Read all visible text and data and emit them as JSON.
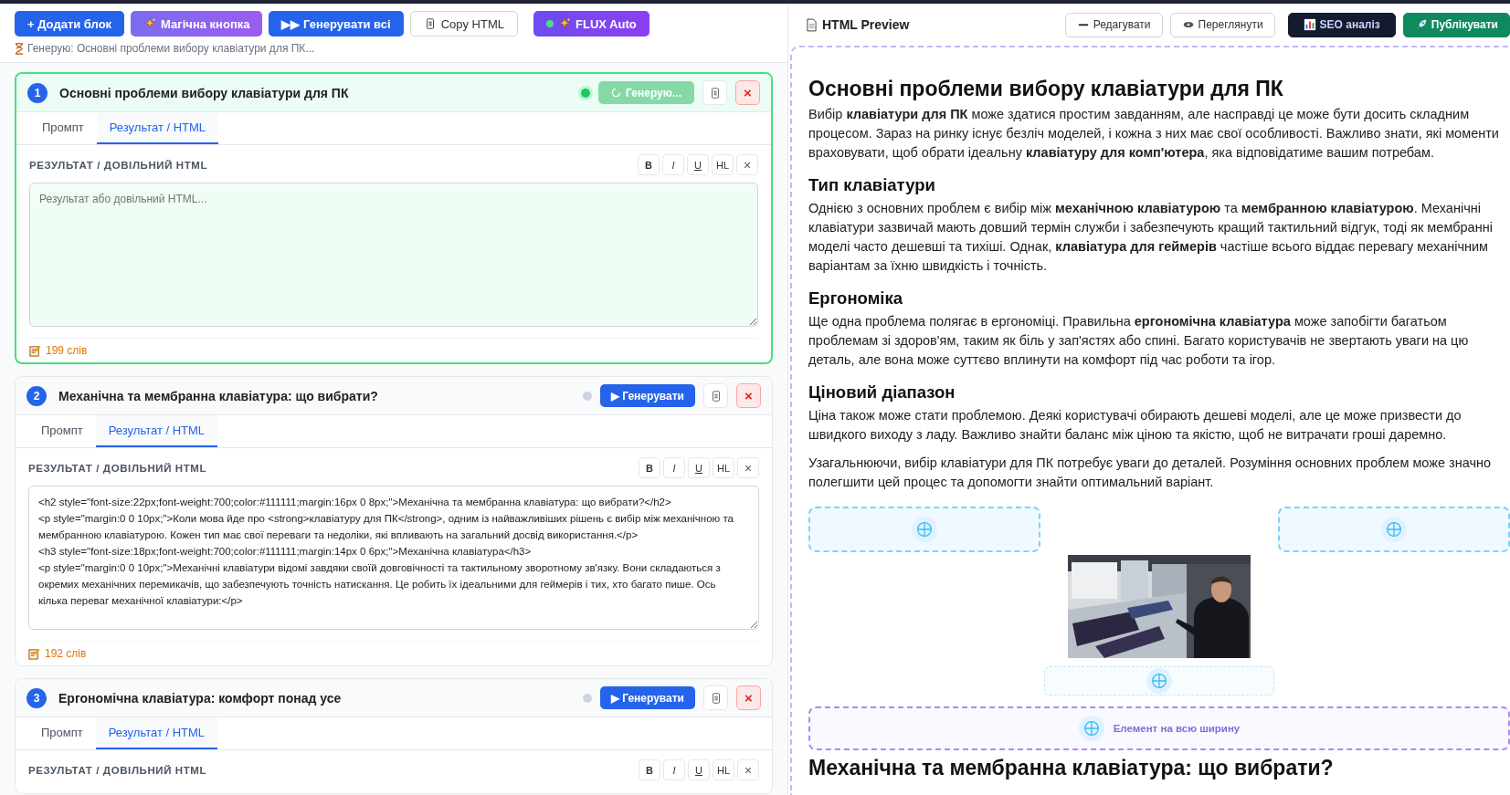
{
  "toolbar": {
    "buttons": [
      {
        "kind": "primary",
        "label": "+ Додати блок"
      },
      {
        "kind": "magic",
        "label": "Магічна кнопка"
      },
      {
        "kind": "primary",
        "label": "▶▶ Генерувати всі"
      },
      {
        "kind": "copy",
        "label": "Copy HTML"
      },
      {
        "kind": "flux",
        "label": "FLUX Auto"
      }
    ],
    "status": "Генерую: Основні проблеми вибору клавіатури для ПК..."
  },
  "blocks": [
    {
      "number": "1",
      "title": "Основні проблеми вибору клавіатури для ПК",
      "generating": true,
      "generate_label": "Генерую...",
      "close": "×",
      "tabs": [
        {
          "label": "Промпт",
          "selected": false
        },
        {
          "label": "Результат / HTML",
          "selected": true
        }
      ],
      "section_label": "РЕЗУЛЬТАТ / ДОВІЛЬНИЙ HTML",
      "format_buttons": [
        "B",
        "I",
        "U",
        "HL",
        "×"
      ],
      "placeholder": "Результат або довільний HTML...",
      "words": "199 слів"
    },
    {
      "number": "2",
      "title": "Механічна та мембранна клавіатура: що вибрати?",
      "generating": false,
      "generate_label": "▶ Генерувати",
      "close": "×",
      "tabs": [
        {
          "label": "Промпт",
          "selected": false
        },
        {
          "label": "Результат / HTML",
          "selected": true
        }
      ],
      "section_label": "РЕЗУЛЬТАТ / ДОВІЛЬНИЙ HTML",
      "format_buttons": [
        "B",
        "I",
        "U",
        "HL",
        "×"
      ],
      "value": "<h2 style=\"font-size:22px;font-weight:700;color:#111111;margin:16px 0 8px;\">Механічна та мембранна клавіатура: що вибрати?</h2>\n<p style=\"margin:0 0 10px;\">Коли мова йде про <strong>клавіатуру для ПК</strong>, одним із найважливіших рішень є вибір між механічною та мембранною клавіатурою. Кожен тип має свої переваги та недоліки, які впливають на загальний досвід використання.</p>\n<h3 style=\"font-size:18px;font-weight:700;color:#111111;margin:14px 0 6px;\">Механічна клавіатура</h3>\n<p style=\"margin:0 0 10px;\">Механічні клавіатури відомі завдяки своїй довговічності та тактильному зворотному зв'язку. Вони складаються з окремих механічних перемикачів, що забезпечують точність натискання. Це робить їх ідеальними для геймерів і тих, хто багато пише. Ось кілька переваг механічної клавіатури:</p>",
      "words": "192 слів"
    },
    {
      "number": "3",
      "title": "Ергономічна клавіатура: комфорт понад усе",
      "generating": false,
      "generate_label": "▶ Генерувати",
      "close": "×",
      "tabs": [
        {
          "label": "Промпт",
          "selected": false
        },
        {
          "label": "Результат / HTML",
          "selected": true
        }
      ],
      "section_label": "РЕЗУЛЬТАТ / ДОВІЛЬНИЙ HTML",
      "format_buttons": [
        "B",
        "I",
        "U",
        "HL",
        "×"
      ]
    }
  ],
  "preview": {
    "title": "HTML Preview",
    "buttons": [
      {
        "kind": "edit",
        "label": "Редагувати"
      },
      {
        "kind": "view",
        "label": "Переглянути"
      },
      {
        "kind": "seo",
        "label": "SEO аналіз"
      },
      {
        "kind": "publish",
        "label": "Публікувати"
      }
    ],
    "content": [
      {
        "kind": "h2",
        "text": "Основні проблеми вибору клавіатури для ПК"
      },
      {
        "kind": "p",
        "text": "Вибір **клавіатури для ПК** може здатися простим завданням, але насправді це може бути досить складним процесом. Зараз на ринку існує безліч моделей, і кожна з них має свої особливості. Важливо знати, які моменти враховувати, щоб обрати ідеальну **клавіатуру для комп'ютера**, яка відповідатиме вашим потребам."
      },
      {
        "kind": "h3",
        "text": "Тип клавіатури"
      },
      {
        "kind": "p",
        "text": "Однією з основних проблем є вибір між **механічною клавіатурою** та **мембранною клавіатурою**. Механічні клавіатури зазвичай мають довший термін служби і забезпечують кращий тактильний відгук, тоді як мембранні моделі часто дешевші та тихіші. Однак, **клавіатура для геймерів** частіше всього віддає перевагу механічним варіантам за їхню швидкість і точність."
      },
      {
        "kind": "h3",
        "text": "Ергономіка"
      },
      {
        "kind": "p",
        "text": "Ще одна проблема полягає в ергономіці. Правильна **ергономічна клавіатура** може запобігти багатьом проблемам зі здоров'ям, таким як біль у зап'ястях або спині. Багато користувачів не звертають уваги на цю деталь, але вона може суттєво вплинути на комфорт під час роботи та ігор."
      },
      {
        "kind": "h3",
        "text": "Ціновий діапазон"
      },
      {
        "kind": "p",
        "text": "Ціна також може стати проблемою. Деякі користувачі обирають дешеві моделі, але це може призвести до швидкого виходу з ладу. Важливо знайти баланс між ціною та якістю, щоб не витрачати гроші даремно."
      },
      {
        "kind": "p",
        "text": "Узагальнюючи, вибір клавіатури для ПК потребує уваги до деталей. Розуміння основних проблем може значно полегшити цей процес та допомогти знайти оптимальний варіант."
      },
      {
        "kind": "slot-pair"
      },
      {
        "kind": "picture"
      },
      {
        "kind": "slot"
      },
      {
        "kind": "wide-slot",
        "label": "Елемент на всю ширину"
      },
      {
        "kind": "h2",
        "text": "Механічна та мембранна клавіатура: що вибрати?"
      }
    ]
  }
}
